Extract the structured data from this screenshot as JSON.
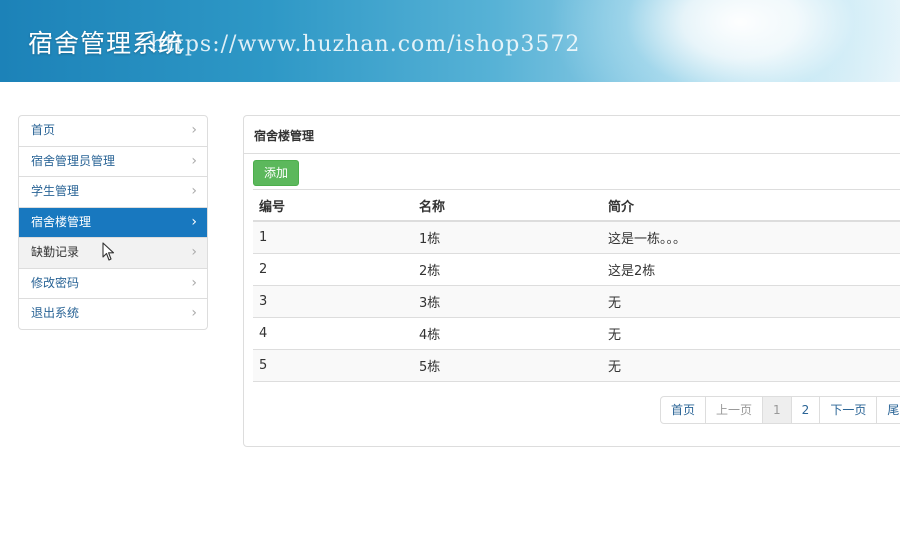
{
  "header": {
    "title": "宿舍管理系统",
    "watermark": "https://www.huzhan.com/ishop3572"
  },
  "sidebar": {
    "items": [
      {
        "label": "首页"
      },
      {
        "label": "宿舍管理员管理"
      },
      {
        "label": "学生管理"
      },
      {
        "label": "宿舍楼管理",
        "active": true
      },
      {
        "label": "缺勤记录"
      },
      {
        "label": "修改密码"
      },
      {
        "label": "退出系统"
      }
    ]
  },
  "panel": {
    "heading": "宿舍楼管理",
    "add_label": "添加",
    "columns": [
      "编号",
      "名称",
      "简介"
    ],
    "rows": [
      [
        "1",
        "1栋",
        "这是一栋。。。"
      ],
      [
        "2",
        "2栋",
        "这是2栋"
      ],
      [
        "3",
        "3栋",
        "无"
      ],
      [
        "4",
        "4栋",
        "无"
      ],
      [
        "5",
        "5栋",
        "无"
      ]
    ]
  },
  "pagination": {
    "first": "首页",
    "prev": "上一页",
    "pages": [
      "1",
      "2"
    ],
    "current": "1",
    "next": "下一页",
    "last": "尾页"
  },
  "colors": {
    "header_blue": "#1c82b8",
    "active_nav": "#1878bf",
    "link": "#2a6496",
    "add_button": "#5cb85c"
  },
  "icons": {
    "nav_chevron": "chevron-right-icon",
    "cursor": "mouse-pointer-icon"
  }
}
